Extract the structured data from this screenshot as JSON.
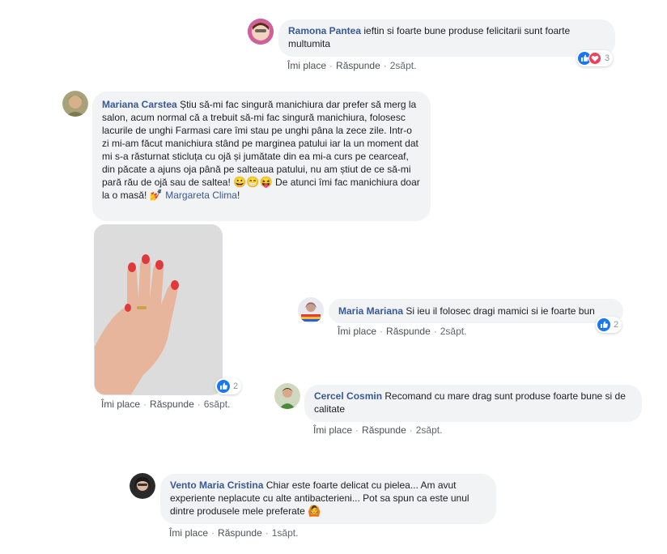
{
  "actions": {
    "like": "Îmi place",
    "reply": "Răspunde",
    "sep": "·"
  },
  "comments": [
    {
      "author": "Ramona Pantea",
      "text": "ieftin si foarte bune produse felicitarii sunt foarte multumita",
      "time": "2săpt.",
      "react_count": "3"
    },
    {
      "author": "Mariana Carstea",
      "text_a": "Știu să-mi fac singură manichiura dar prefer să merg la salon, acum normal că a trebuit să-mi fac singură manichiura, folosesc lacurile de unghi Farmasi care îmi stau pe unghi pâna la zece zile. Intr-o zi mi-am făcut manichiura stând pe marginea patului iar la un moment dat mi s-a răsturnat sticluța cu ojă și jumătate din ea mi-a curs pe cearceaf, din păcate a ajuns oja până pe salteaua patului, nu am știut de ce să-mi pară rău de ojă sau de saltea!",
      "text_b": "De atunci îmi fac manichiura doar la o masă!",
      "mention": "Margareta Clima",
      "after_mention": "!",
      "time": "6săpt.",
      "react_count": "2"
    },
    {
      "author": "Maria Mariana",
      "text": "Si ieu il folosec dragi mamici si ie foarte bun",
      "time": "2săpt.",
      "react_count": "2"
    },
    {
      "author": "Cercel Cosmin",
      "text": "Recomand cu mare drag sunt produse foarte bune si de calitate",
      "time": "2săpt."
    },
    {
      "author": "Vento Maria Cristina",
      "text": "Chiar este foarte delicat cu pielea... Am avut experiente neplacute cu alte antibacterieni... Pot sa spun ca este unul dintre produsele mele preferate",
      "time": "1săpt."
    }
  ],
  "emojis": {
    "laughs": "😀😁😝",
    "nail": "💅",
    "woman": "🙆"
  },
  "colors": {
    "link": "#385898",
    "bubble": "#f2f3f5",
    "like": "#1877f2",
    "love": "#f33e58"
  }
}
